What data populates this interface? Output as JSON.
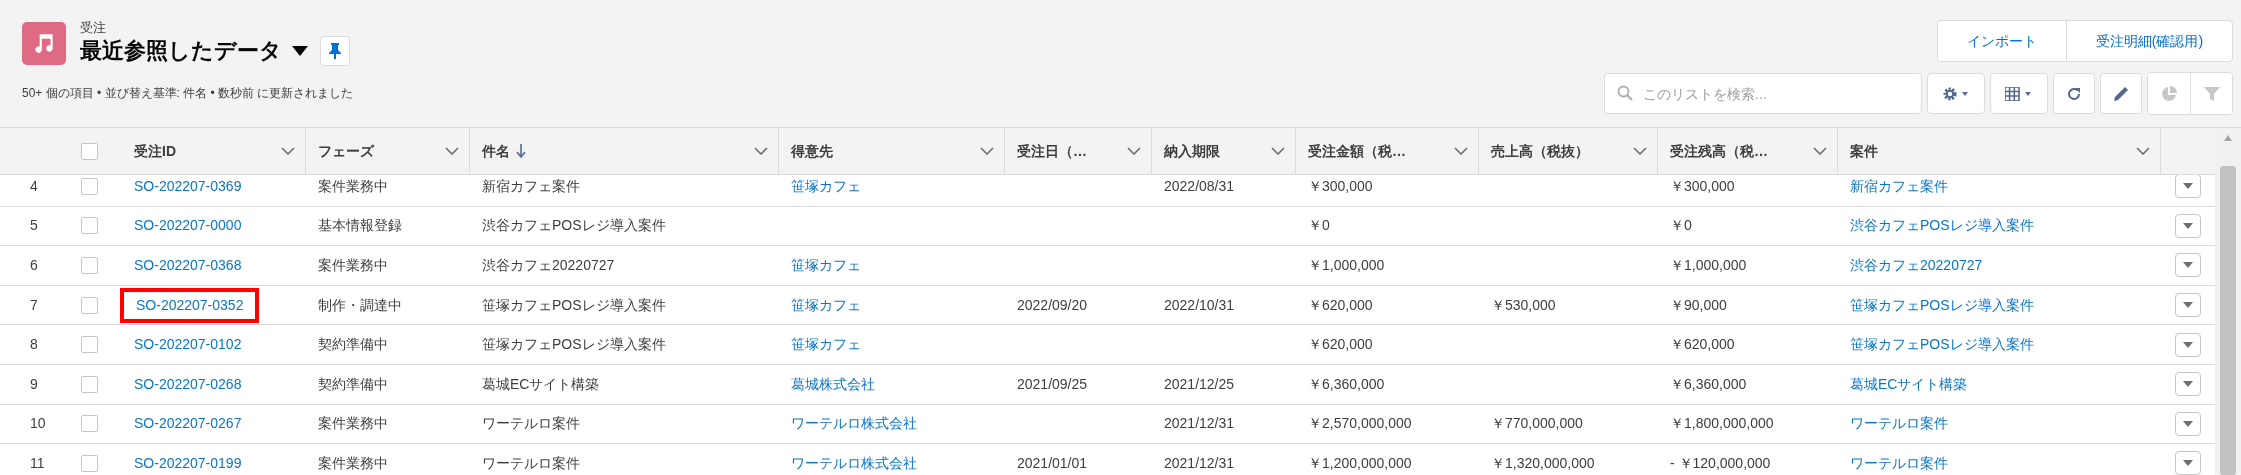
{
  "header": {
    "object_label": "受注",
    "list_name": "最近参照したデータ",
    "summary": "50+ 個の項目 • 並び替え基準: 件名 • 数秒前 に更新されました"
  },
  "actions": [
    "インポート",
    "受注明細(確認用)"
  ],
  "search": {
    "placeholder": "このリストを検索..."
  },
  "toolbar": [
    {
      "kind": "settings",
      "disabled": false
    },
    {
      "kind": "table",
      "disabled": false
    },
    {
      "kind": "refresh",
      "disabled": false
    },
    {
      "kind": "edit",
      "disabled": false
    },
    {
      "kind": "chart",
      "disabled": true
    },
    {
      "kind": "filter",
      "disabled": true
    }
  ],
  "table": {
    "all_checked": false,
    "columns": [
      {
        "label": "受注ID",
        "sorted": false,
        "kind": "link"
      },
      {
        "label": "フェーズ",
        "sorted": false,
        "kind": "text"
      },
      {
        "label": "件名",
        "sorted": true,
        "kind": "text"
      },
      {
        "label": "得意先",
        "sorted": false,
        "kind": "link"
      },
      {
        "label": "受注日（…",
        "sorted": false,
        "kind": "text"
      },
      {
        "label": "納入期限",
        "sorted": false,
        "kind": "text"
      },
      {
        "label": "受注金額（税…",
        "sorted": false,
        "kind": "text"
      },
      {
        "label": "売上高（税抜）",
        "sorted": false,
        "kind": "text"
      },
      {
        "label": "受注残高（税…",
        "sorted": false,
        "kind": "text"
      },
      {
        "label": "案件",
        "sorted": false,
        "kind": "link"
      }
    ],
    "rows": [
      {
        "number": "4",
        "checked": false,
        "highlighted": false,
        "cells": [
          "SO-202207-0369",
          "案件業務中",
          "新宿カフェ案件",
          "笹塚カフェ",
          null,
          "2022/08/31",
          "￥300,000",
          null,
          "￥300,000",
          "新宿カフェ案件"
        ]
      },
      {
        "number": "5",
        "checked": false,
        "highlighted": false,
        "cells": [
          "SO-202207-0000",
          "基本情報登録",
          "渋谷カフェPOSレジ導入案件",
          null,
          null,
          null,
          "￥0",
          null,
          "￥0",
          "渋谷カフェPOSレジ導入案件"
        ]
      },
      {
        "number": "6",
        "checked": false,
        "highlighted": false,
        "cells": [
          "SO-202207-0368",
          "案件業務中",
          "渋谷カフェ20220727",
          "笹塚カフェ",
          null,
          null,
          "￥1,000,000",
          null,
          "￥1,000,000",
          "渋谷カフェ20220727"
        ]
      },
      {
        "number": "7",
        "checked": false,
        "highlighted": true,
        "cells": [
          "SO-202207-0352",
          "制作・調達中",
          "笹塚カフェPOSレジ導入案件",
          "笹塚カフェ",
          "2022/09/20",
          "2022/10/31",
          "￥620,000",
          "￥530,000",
          "￥90,000",
          "笹塚カフェPOSレジ導入案件"
        ]
      },
      {
        "number": "8",
        "checked": false,
        "highlighted": false,
        "cells": [
          "SO-202207-0102",
          "契約準備中",
          "笹塚カフェPOSレジ導入案件",
          "笹塚カフェ",
          null,
          null,
          "￥620,000",
          null,
          "￥620,000",
          "笹塚カフェPOSレジ導入案件"
        ]
      },
      {
        "number": "9",
        "checked": false,
        "highlighted": false,
        "cells": [
          "SO-202207-0268",
          "契約準備中",
          "葛城ECサイト構築",
          "葛城株式会社",
          "2021/09/25",
          "2021/12/25",
          "￥6,360,000",
          null,
          "￥6,360,000",
          "葛城ECサイト構築"
        ]
      },
      {
        "number": "10",
        "checked": false,
        "highlighted": false,
        "cells": [
          "SO-202207-0267",
          "案件業務中",
          "ワーテルロ案件",
          "ワーテルロ株式会社",
          null,
          "2021/12/31",
          "￥2,570,000,000",
          "￥770,000,000",
          "￥1,800,000,000",
          "ワーテルロ案件"
        ]
      },
      {
        "number": "11",
        "checked": false,
        "highlighted": false,
        "cells": [
          "SO-202207-0199",
          "案件業務中",
          "ワーテルロ案件",
          "ワーテルロ株式会社",
          "2021/01/01",
          "2021/12/31",
          "￥1,200,000,000",
          "￥1,320,000,000",
          "- ￥120,000,000",
          "ワーテルロ案件"
        ]
      }
    ]
  }
}
